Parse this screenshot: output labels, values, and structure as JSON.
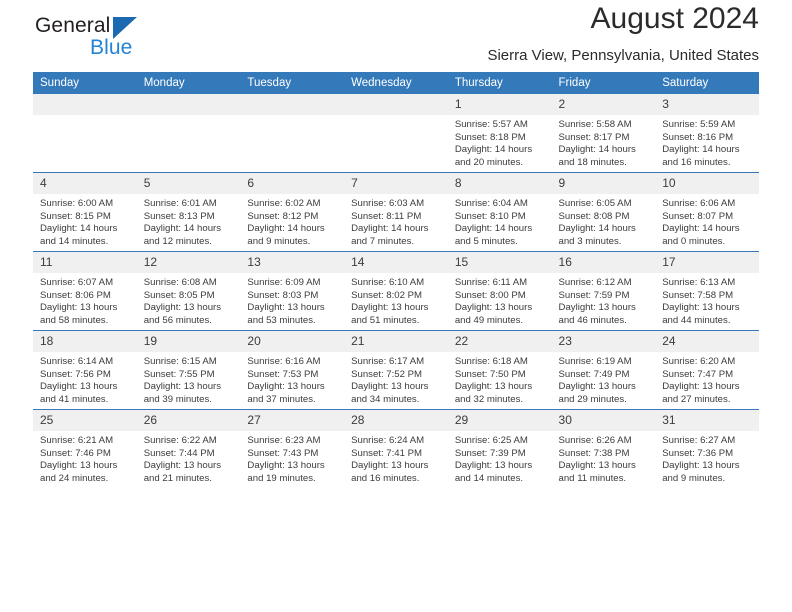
{
  "brand": {
    "name_part1": "General",
    "name_part2": "Blue",
    "flag_color": "#1b69b1",
    "blue_text_color": "#2383d4"
  },
  "header": {
    "title": "August 2024",
    "subtitle": "Sierra View, Pennsylvania, United States"
  },
  "calendar": {
    "header_bg": "#3479ba",
    "daynum_bg": "#f0f0f0",
    "weekdays": [
      "Sunday",
      "Monday",
      "Tuesday",
      "Wednesday",
      "Thursday",
      "Friday",
      "Saturday"
    ],
    "labels": {
      "sunrise": "Sunrise:",
      "sunset": "Sunset:",
      "daylight": "Daylight:"
    },
    "weeks": [
      [
        {
          "day": "",
          "sunrise": "",
          "sunset": "",
          "daylight_line1": "",
          "daylight_line2": ""
        },
        {
          "day": "",
          "sunrise": "",
          "sunset": "",
          "daylight_line1": "",
          "daylight_line2": ""
        },
        {
          "day": "",
          "sunrise": "",
          "sunset": "",
          "daylight_line1": "",
          "daylight_line2": ""
        },
        {
          "day": "",
          "sunrise": "",
          "sunset": "",
          "daylight_line1": "",
          "daylight_line2": ""
        },
        {
          "day": "1",
          "sunrise": "Sunrise: 5:57 AM",
          "sunset": "Sunset: 8:18 PM",
          "daylight_line1": "Daylight: 14 hours",
          "daylight_line2": "and 20 minutes."
        },
        {
          "day": "2",
          "sunrise": "Sunrise: 5:58 AM",
          "sunset": "Sunset: 8:17 PM",
          "daylight_line1": "Daylight: 14 hours",
          "daylight_line2": "and 18 minutes."
        },
        {
          "day": "3",
          "sunrise": "Sunrise: 5:59 AM",
          "sunset": "Sunset: 8:16 PM",
          "daylight_line1": "Daylight: 14 hours",
          "daylight_line2": "and 16 minutes."
        }
      ],
      [
        {
          "day": "4",
          "sunrise": "Sunrise: 6:00 AM",
          "sunset": "Sunset: 8:15 PM",
          "daylight_line1": "Daylight: 14 hours",
          "daylight_line2": "and 14 minutes."
        },
        {
          "day": "5",
          "sunrise": "Sunrise: 6:01 AM",
          "sunset": "Sunset: 8:13 PM",
          "daylight_line1": "Daylight: 14 hours",
          "daylight_line2": "and 12 minutes."
        },
        {
          "day": "6",
          "sunrise": "Sunrise: 6:02 AM",
          "sunset": "Sunset: 8:12 PM",
          "daylight_line1": "Daylight: 14 hours",
          "daylight_line2": "and 9 minutes."
        },
        {
          "day": "7",
          "sunrise": "Sunrise: 6:03 AM",
          "sunset": "Sunset: 8:11 PM",
          "daylight_line1": "Daylight: 14 hours",
          "daylight_line2": "and 7 minutes."
        },
        {
          "day": "8",
          "sunrise": "Sunrise: 6:04 AM",
          "sunset": "Sunset: 8:10 PM",
          "daylight_line1": "Daylight: 14 hours",
          "daylight_line2": "and 5 minutes."
        },
        {
          "day": "9",
          "sunrise": "Sunrise: 6:05 AM",
          "sunset": "Sunset: 8:08 PM",
          "daylight_line1": "Daylight: 14 hours",
          "daylight_line2": "and 3 minutes."
        },
        {
          "day": "10",
          "sunrise": "Sunrise: 6:06 AM",
          "sunset": "Sunset: 8:07 PM",
          "daylight_line1": "Daylight: 14 hours",
          "daylight_line2": "and 0 minutes."
        }
      ],
      [
        {
          "day": "11",
          "sunrise": "Sunrise: 6:07 AM",
          "sunset": "Sunset: 8:06 PM",
          "daylight_line1": "Daylight: 13 hours",
          "daylight_line2": "and 58 minutes."
        },
        {
          "day": "12",
          "sunrise": "Sunrise: 6:08 AM",
          "sunset": "Sunset: 8:05 PM",
          "daylight_line1": "Daylight: 13 hours",
          "daylight_line2": "and 56 minutes."
        },
        {
          "day": "13",
          "sunrise": "Sunrise: 6:09 AM",
          "sunset": "Sunset: 8:03 PM",
          "daylight_line1": "Daylight: 13 hours",
          "daylight_line2": "and 53 minutes."
        },
        {
          "day": "14",
          "sunrise": "Sunrise: 6:10 AM",
          "sunset": "Sunset: 8:02 PM",
          "daylight_line1": "Daylight: 13 hours",
          "daylight_line2": "and 51 minutes."
        },
        {
          "day": "15",
          "sunrise": "Sunrise: 6:11 AM",
          "sunset": "Sunset: 8:00 PM",
          "daylight_line1": "Daylight: 13 hours",
          "daylight_line2": "and 49 minutes."
        },
        {
          "day": "16",
          "sunrise": "Sunrise: 6:12 AM",
          "sunset": "Sunset: 7:59 PM",
          "daylight_line1": "Daylight: 13 hours",
          "daylight_line2": "and 46 minutes."
        },
        {
          "day": "17",
          "sunrise": "Sunrise: 6:13 AM",
          "sunset": "Sunset: 7:58 PM",
          "daylight_line1": "Daylight: 13 hours",
          "daylight_line2": "and 44 minutes."
        }
      ],
      [
        {
          "day": "18",
          "sunrise": "Sunrise: 6:14 AM",
          "sunset": "Sunset: 7:56 PM",
          "daylight_line1": "Daylight: 13 hours",
          "daylight_line2": "and 41 minutes."
        },
        {
          "day": "19",
          "sunrise": "Sunrise: 6:15 AM",
          "sunset": "Sunset: 7:55 PM",
          "daylight_line1": "Daylight: 13 hours",
          "daylight_line2": "and 39 minutes."
        },
        {
          "day": "20",
          "sunrise": "Sunrise: 6:16 AM",
          "sunset": "Sunset: 7:53 PM",
          "daylight_line1": "Daylight: 13 hours",
          "daylight_line2": "and 37 minutes."
        },
        {
          "day": "21",
          "sunrise": "Sunrise: 6:17 AM",
          "sunset": "Sunset: 7:52 PM",
          "daylight_line1": "Daylight: 13 hours",
          "daylight_line2": "and 34 minutes."
        },
        {
          "day": "22",
          "sunrise": "Sunrise: 6:18 AM",
          "sunset": "Sunset: 7:50 PM",
          "daylight_line1": "Daylight: 13 hours",
          "daylight_line2": "and 32 minutes."
        },
        {
          "day": "23",
          "sunrise": "Sunrise: 6:19 AM",
          "sunset": "Sunset: 7:49 PM",
          "daylight_line1": "Daylight: 13 hours",
          "daylight_line2": "and 29 minutes."
        },
        {
          "day": "24",
          "sunrise": "Sunrise: 6:20 AM",
          "sunset": "Sunset: 7:47 PM",
          "daylight_line1": "Daylight: 13 hours",
          "daylight_line2": "and 27 minutes."
        }
      ],
      [
        {
          "day": "25",
          "sunrise": "Sunrise: 6:21 AM",
          "sunset": "Sunset: 7:46 PM",
          "daylight_line1": "Daylight: 13 hours",
          "daylight_line2": "and 24 minutes."
        },
        {
          "day": "26",
          "sunrise": "Sunrise: 6:22 AM",
          "sunset": "Sunset: 7:44 PM",
          "daylight_line1": "Daylight: 13 hours",
          "daylight_line2": "and 21 minutes."
        },
        {
          "day": "27",
          "sunrise": "Sunrise: 6:23 AM",
          "sunset": "Sunset: 7:43 PM",
          "daylight_line1": "Daylight: 13 hours",
          "daylight_line2": "and 19 minutes."
        },
        {
          "day": "28",
          "sunrise": "Sunrise: 6:24 AM",
          "sunset": "Sunset: 7:41 PM",
          "daylight_line1": "Daylight: 13 hours",
          "daylight_line2": "and 16 minutes."
        },
        {
          "day": "29",
          "sunrise": "Sunrise: 6:25 AM",
          "sunset": "Sunset: 7:39 PM",
          "daylight_line1": "Daylight: 13 hours",
          "daylight_line2": "and 14 minutes."
        },
        {
          "day": "30",
          "sunrise": "Sunrise: 6:26 AM",
          "sunset": "Sunset: 7:38 PM",
          "daylight_line1": "Daylight: 13 hours",
          "daylight_line2": "and 11 minutes."
        },
        {
          "day": "31",
          "sunrise": "Sunrise: 6:27 AM",
          "sunset": "Sunset: 7:36 PM",
          "daylight_line1": "Daylight: 13 hours",
          "daylight_line2": "and 9 minutes."
        }
      ]
    ]
  }
}
